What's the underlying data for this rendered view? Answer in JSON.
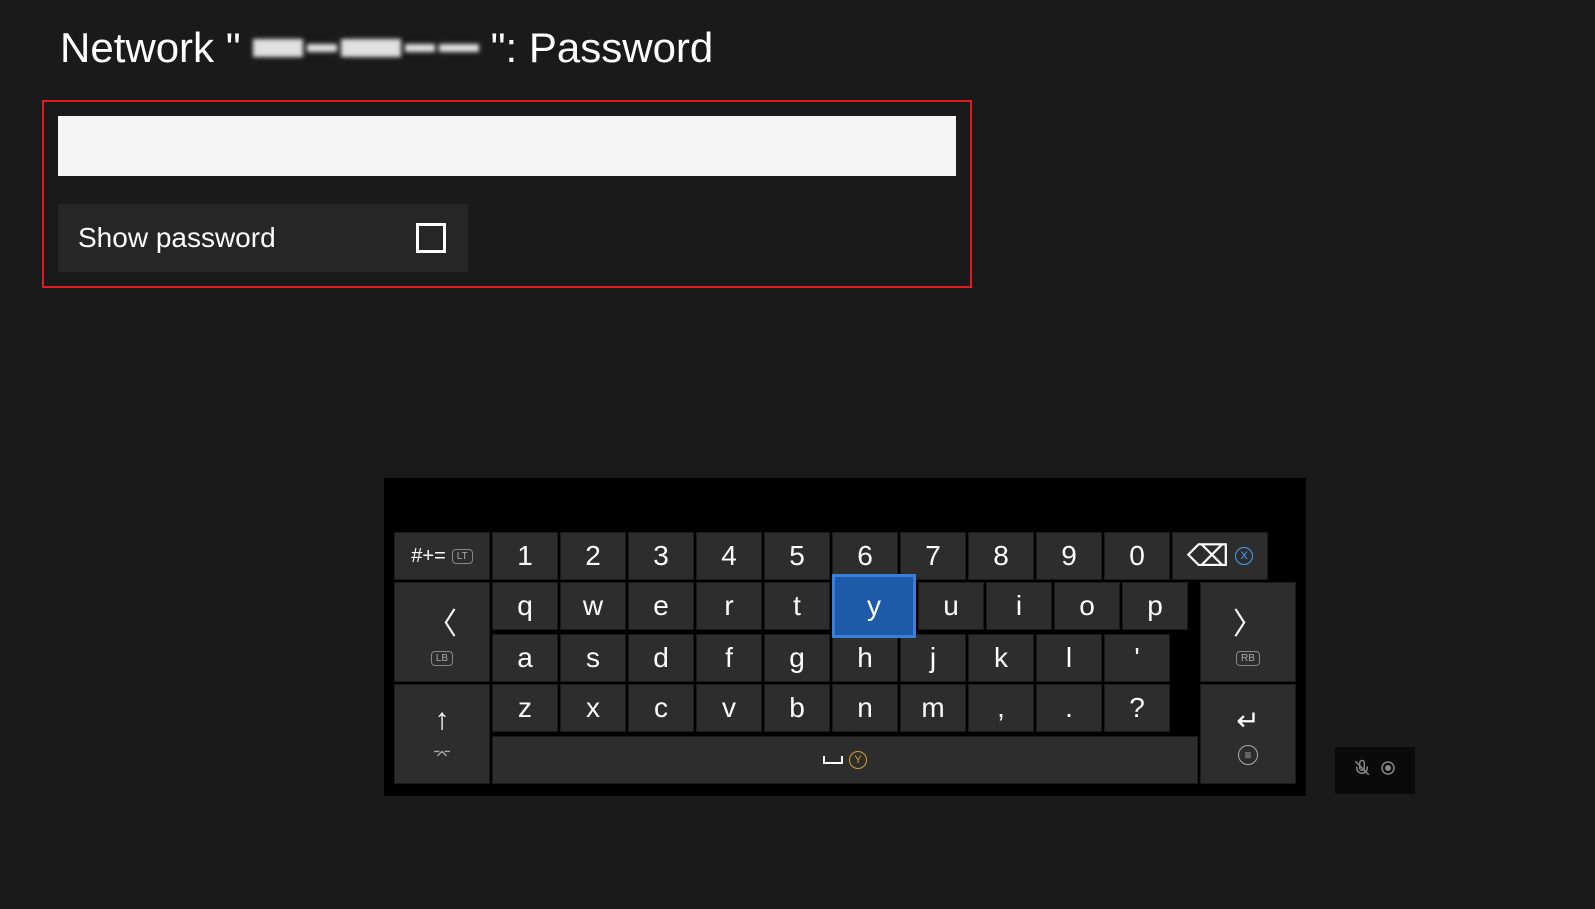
{
  "header": {
    "prefix": "Network \"",
    "suffix": "\": Password"
  },
  "input": {
    "password_value": "",
    "show_password_label": "Show password"
  },
  "keyboard": {
    "row_sym": "#+=",
    "lt_badge": "LT",
    "numbers": [
      "1",
      "2",
      "3",
      "4",
      "5",
      "6",
      "7",
      "8",
      "9",
      "0"
    ],
    "x_badge": "X",
    "row2": [
      "q",
      "w",
      "e",
      "r",
      "t",
      "y",
      "u",
      "i",
      "o",
      "p"
    ],
    "highlighted_key": "y",
    "lb_badge": "LB",
    "rb_badge": "RB",
    "row3": [
      "a",
      "s",
      "d",
      "f",
      "g",
      "h",
      "j",
      "k",
      "l",
      "'"
    ],
    "row4": [
      "z",
      "x",
      "c",
      "v",
      "b",
      "n",
      "m",
      ",",
      ".",
      "?"
    ],
    "y_badge": "Y"
  }
}
